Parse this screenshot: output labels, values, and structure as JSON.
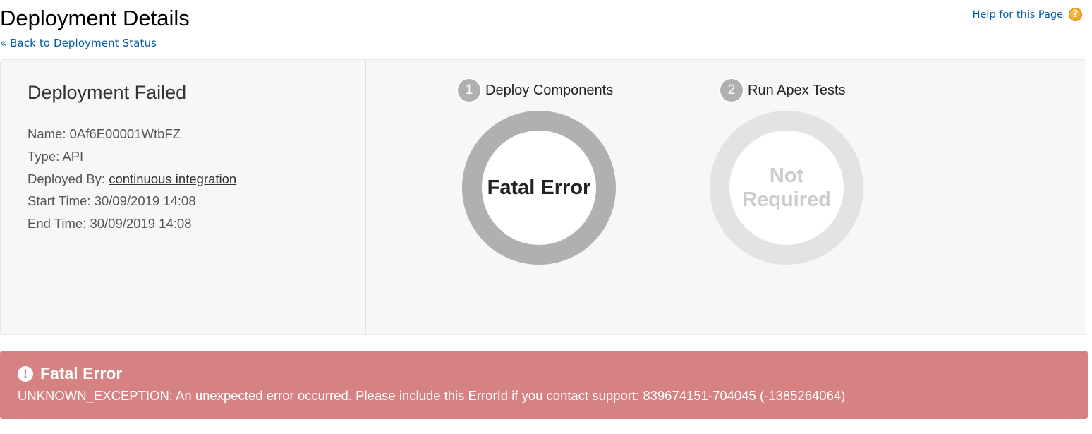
{
  "header": {
    "title": "Deployment Details",
    "back_link": "« Back to Deployment Status",
    "help_link": "Help for this Page",
    "help_icon": "?"
  },
  "summary": {
    "heading": "Deployment Failed",
    "name_label": "Name:",
    "name_value": "0Af6E00001WtbFZ",
    "type_label": "Type:",
    "type_value": "API",
    "deployed_by_label": "Deployed By:",
    "deployed_by_value": "continuous integration",
    "start_label": "Start Time:",
    "start_value": "30/09/2019 14:08",
    "end_label": "End Time:",
    "end_value": "30/09/2019 14:08"
  },
  "stages": [
    {
      "number": "1",
      "label": "Deploy Components",
      "status": "Fatal Error",
      "ring_color": "#b0b0b0"
    },
    {
      "number": "2",
      "label": "Run Apex Tests",
      "status": "Not Required",
      "ring_color": "#e3e3e3"
    }
  ],
  "error": {
    "icon": "!",
    "title": "Fatal Error",
    "message": "UNKNOWN_EXCEPTION: An unexpected error occurred. Please include this ErrorId if you contact support: 839674151-704045 (-1385264064)",
    "background": "#d68182"
  }
}
